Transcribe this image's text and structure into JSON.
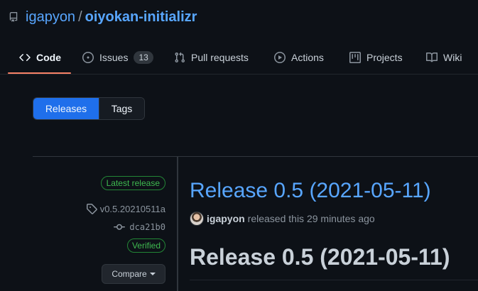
{
  "repo": {
    "owner": "igapyon",
    "separator": "/",
    "name": "oiyokan-initializr"
  },
  "tabs": [
    {
      "label": "Code",
      "icon": "code-icon",
      "selected": true
    },
    {
      "label": "Issues",
      "icon": "issue-opened-icon",
      "count": "13"
    },
    {
      "label": "Pull requests",
      "icon": "git-pull-request-icon"
    },
    {
      "label": "Actions",
      "icon": "play-icon"
    },
    {
      "label": "Projects",
      "icon": "project-icon"
    },
    {
      "label": "Wiki",
      "icon": "book-icon"
    }
  ],
  "subnav": {
    "releases": "Releases",
    "tags": "Tags"
  },
  "release": {
    "latest_badge": "Latest release",
    "tag": "v0.5.20210511a",
    "commit": "dca21b0",
    "verified": "Verified",
    "compare": "Compare",
    "title": "Release 0.5 (2021-05-11)",
    "author": "igapyon",
    "released_text": "released this 29 minutes ago",
    "body_heading": "Release 0.5 (2021-05-11)"
  },
  "colors": {
    "background": "#0d1117",
    "link": "#58a6ff",
    "accent_underline": "#f78166",
    "primary_button": "#1f6feb",
    "success": "#3fb950"
  }
}
